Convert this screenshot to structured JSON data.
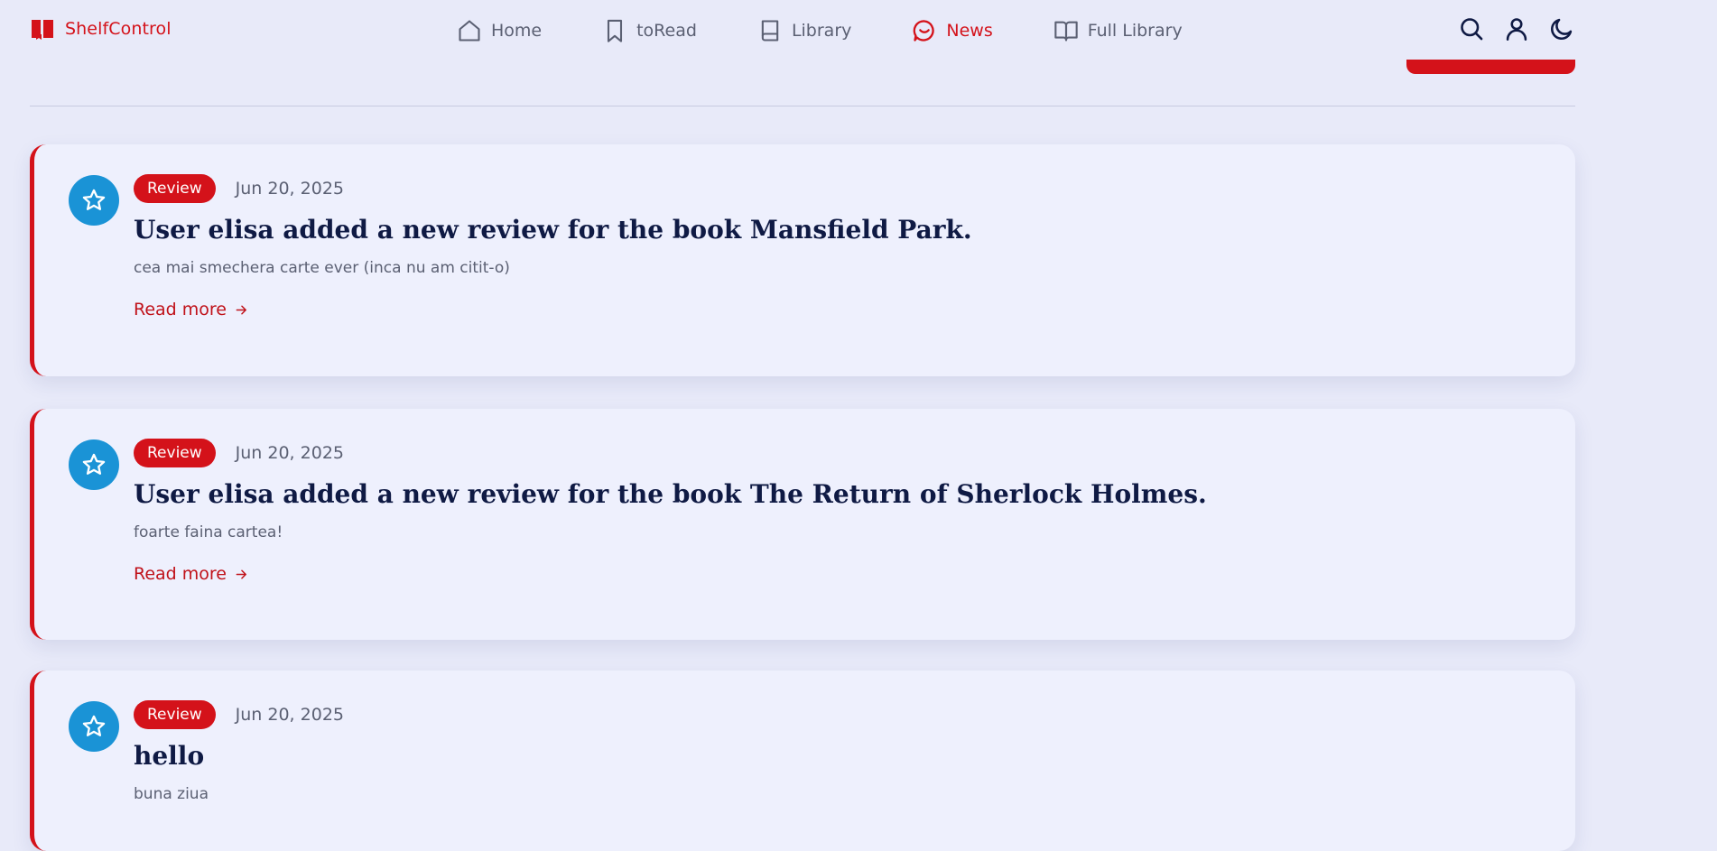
{
  "brand": {
    "name": "ShelfControl",
    "logo_icon": "book-open-icon",
    "accent": "#d4121a"
  },
  "nav": {
    "items": [
      {
        "label": "Home",
        "icon": "home-icon",
        "active": false
      },
      {
        "label": "toRead",
        "icon": "bookmark-icon",
        "active": false
      },
      {
        "label": "Library",
        "icon": "book-icon",
        "active": false
      },
      {
        "label": "News",
        "icon": "message-icon",
        "active": true
      },
      {
        "label": "Full Library",
        "icon": "book-open-icon",
        "active": false
      }
    ]
  },
  "actions": [
    {
      "icon": "search-icon"
    },
    {
      "icon": "user-icon"
    },
    {
      "icon": "moon-icon"
    }
  ],
  "colors": {
    "background": "#e8eaf9",
    "card": "#eef0fd",
    "accent": "#d4121a",
    "icon_bg": "#1a93d6"
  },
  "cards": [
    {
      "badge": "Review",
      "date": "Jun 20, 2025",
      "title_prefix": "User ",
      "user": "elisa",
      "title_middle": " added a new review for the book ",
      "book": "Mansfield Park",
      "title_suffix": ".",
      "excerpt": "cea mai smechera carte ever (inca nu am citit-o)",
      "link": "Read more"
    },
    {
      "badge": "Review",
      "date": "Jun 20, 2025",
      "title_prefix": "User ",
      "user": "elisa",
      "title_middle": " added a new review for the book ",
      "book": "The Return of Sherlock Holmes",
      "title_suffix": ".",
      "excerpt": "foarte faina cartea!",
      "link": "Read more"
    },
    {
      "badge": "Review",
      "date": "Jun 20, 2025",
      "title_plain": "hello",
      "excerpt": "buna ziua"
    }
  ]
}
